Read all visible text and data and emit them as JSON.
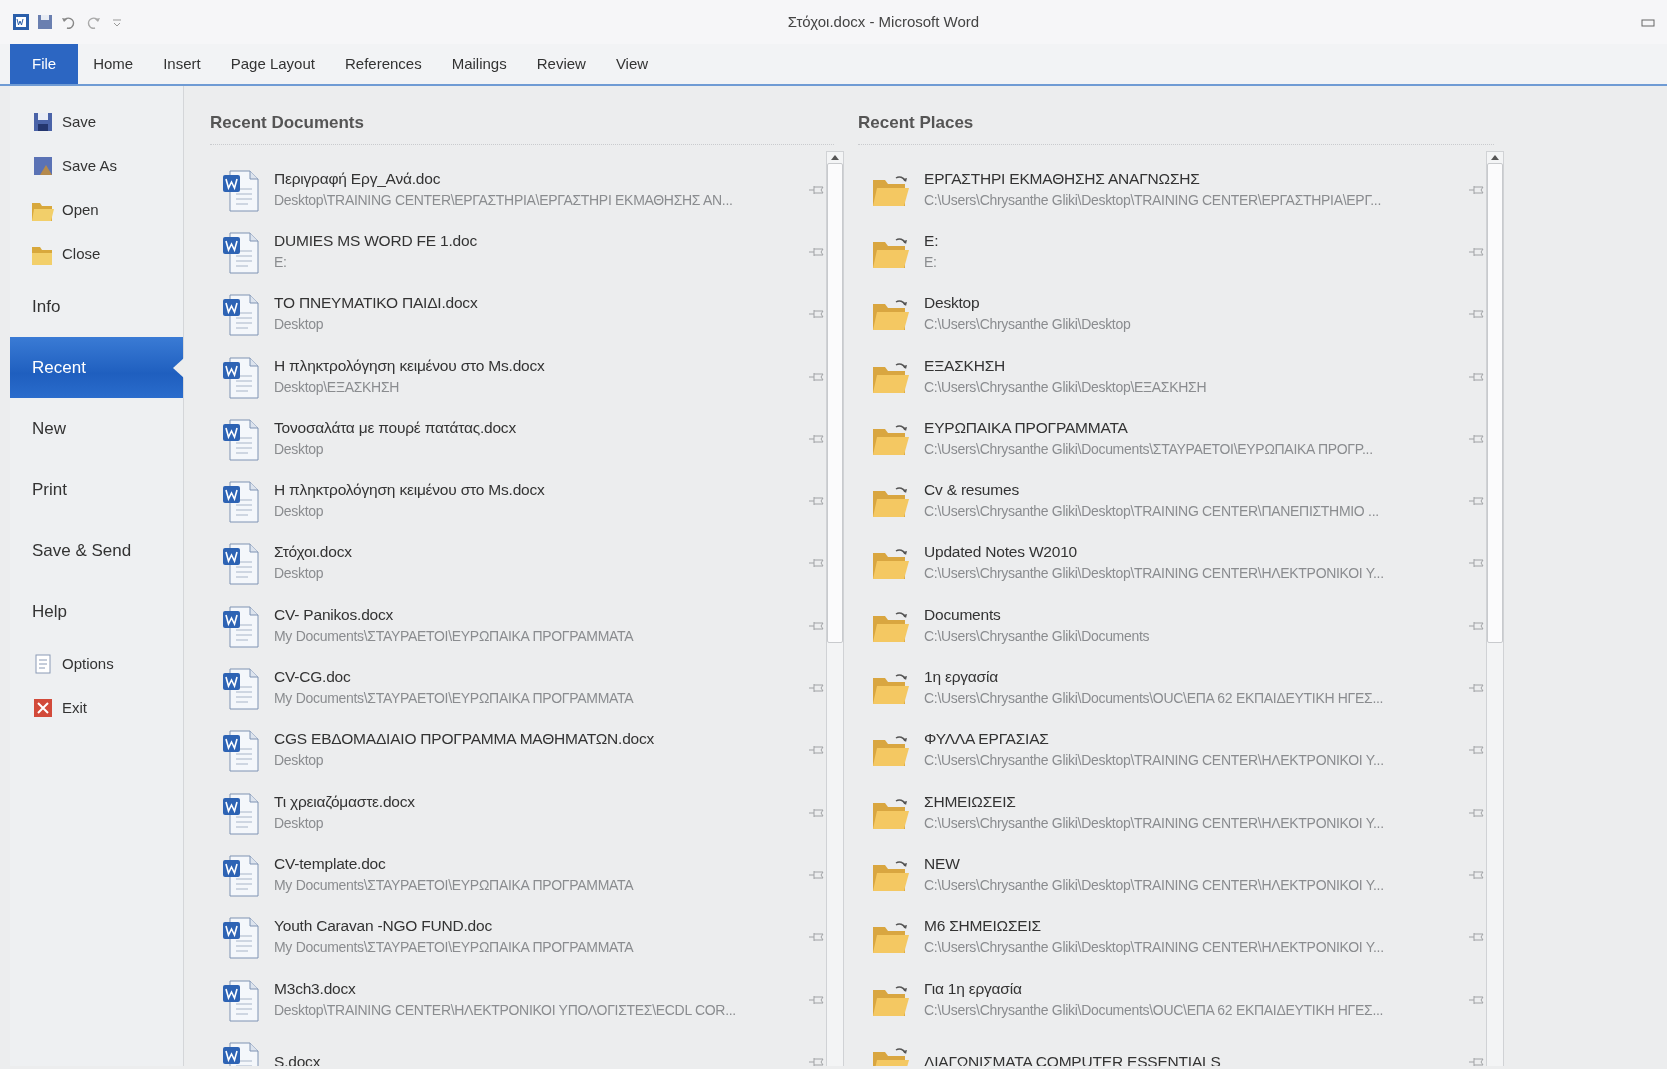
{
  "window": {
    "title": "Στόχοι.docx - Microsoft Word"
  },
  "tabs": [
    {
      "label": "File",
      "selected": true
    },
    {
      "label": "Home",
      "selected": false
    },
    {
      "label": "Insert",
      "selected": false
    },
    {
      "label": "Page Layout",
      "selected": false
    },
    {
      "label": "References",
      "selected": false
    },
    {
      "label": "Mailings",
      "selected": false
    },
    {
      "label": "Review",
      "selected": false
    },
    {
      "label": "View",
      "selected": false
    }
  ],
  "backstage_menu": [
    {
      "label": "Save",
      "kind": "command",
      "selected": false
    },
    {
      "label": "Save As",
      "kind": "command",
      "selected": false
    },
    {
      "label": "Open",
      "kind": "command",
      "selected": false
    },
    {
      "label": "Close",
      "kind": "command",
      "selected": false
    },
    {
      "label": "Info",
      "kind": "page",
      "selected": false
    },
    {
      "label": "Recent",
      "kind": "page",
      "selected": true
    },
    {
      "label": "New",
      "kind": "page",
      "selected": false
    },
    {
      "label": "Print",
      "kind": "page",
      "selected": false
    },
    {
      "label": "Save & Send",
      "kind": "page",
      "selected": false
    },
    {
      "label": "Help",
      "kind": "page",
      "selected": false
    },
    {
      "label": "Options",
      "kind": "command",
      "selected": false
    },
    {
      "label": "Exit",
      "kind": "command",
      "selected": false
    }
  ],
  "recent_documents": {
    "title": "Recent Documents",
    "items": [
      {
        "name": "Περιγραφή Εργ_Ανά.doc",
        "path": "Desktop\\TRAINING CENTER\\ΕΡΓΑΣΤΗΡΙΑ\\ΕΡΓΑΣΤΗΡΙ ΕΚΜΑΘΗΣΗΣ ΑΝ..."
      },
      {
        "name": "DUMIES MS WORD FE  1.doc",
        "path": "E:"
      },
      {
        "name": "ΤΟ ΠΝΕΥΜΑΤΙΚΟ ΠΑΙΔΙ.docx",
        "path": "Desktop"
      },
      {
        "name": "Η πληκτρολόγηση κειμένου στο Ms.docx",
        "path": "Desktop\\ΕΞΑΣΚΗΣΗ"
      },
      {
        "name": "Τονοσαλάτα με πουρέ πατάτας.docx",
        "path": "Desktop"
      },
      {
        "name": "Η πληκτρολόγηση κειμένου στο Ms.docx",
        "path": "Desktop"
      },
      {
        "name": "Στόχοι.docx",
        "path": "Desktop"
      },
      {
        "name": "CV- Panikos.docx",
        "path": "My Documents\\ΣΤΑΥΡΑΕΤΟΙ\\ΕΥΡΩΠΑΙΚΑ ΠΡΟΓΡΑΜΜΑΤΑ"
      },
      {
        "name": "CV-CG.doc",
        "path": "My Documents\\ΣΤΑΥΡΑΕΤΟΙ\\ΕΥΡΩΠΑΙΚΑ ΠΡΟΓΡΑΜΜΑΤΑ"
      },
      {
        "name": "CGS ΕΒΔΟΜΑΔΙΑΙΟ ΠΡΟΓΡΑΜΜΑ ΜΑΘΗΜΑΤΩΝ.docx",
        "path": "Desktop"
      },
      {
        "name": "Τι χρειαζόμαστε.docx",
        "path": "Desktop"
      },
      {
        "name": "CV-template.doc",
        "path": "My Documents\\ΣΤΑΥΡΑΕΤΟΙ\\ΕΥΡΩΠΑΙΚΑ ΠΡΟΓΡΑΜΜΑΤΑ"
      },
      {
        "name": "Youth Caravan -NGO FUND.doc",
        "path": "My Documents\\ΣΤΑΥΡΑΕΤΟΙ\\ΕΥΡΩΠΑΙΚΑ ΠΡΟΓΡΑΜΜΑΤΑ"
      },
      {
        "name": "M3ch3.docx",
        "path": "Desktop\\TRAINING CENTER\\ΗΛΕΚΤΡΟΝΙΚΟΙ ΥΠΟΛΟΓΙΣΤΕΣ\\ECDL COR..."
      },
      {
        "name": "S.docx"
      }
    ]
  },
  "recent_places": {
    "title": "Recent Places",
    "items": [
      {
        "name": "ΕΡΓΑΣΤΗΡΙ ΕΚΜΑΘΗΣΗΣ ΑΝΑΓΝΩΣΗΣ",
        "path": "C:\\Users\\Chrysanthe Gliki\\Desktop\\TRAINING CENTER\\ΕΡΓΑΣΤΗΡΙΑ\\ΕΡΓ..."
      },
      {
        "name": "E:",
        "path": "E:"
      },
      {
        "name": "Desktop",
        "path": "C:\\Users\\Chrysanthe Gliki\\Desktop"
      },
      {
        "name": "ΕΞΑΣΚΗΣΗ",
        "path": "C:\\Users\\Chrysanthe Gliki\\Desktop\\ΕΞΑΣΚΗΣΗ"
      },
      {
        "name": "ΕΥΡΩΠΑΙΚΑ ΠΡΟΓΡΑΜΜΑΤΑ",
        "path": "C:\\Users\\Chrysanthe Gliki\\Documents\\ΣΤΑΥΡΑΕΤΟΙ\\ΕΥΡΩΠΑΙΚΑ ΠΡΟΓΡ..."
      },
      {
        "name": "Cv & resumes",
        "path": "C:\\Users\\Chrysanthe Gliki\\Desktop\\TRAINING CENTER\\ΠΑΝΕΠΙΣΤΗΜΙΟ ..."
      },
      {
        "name": "Updated Notes W2010",
        "path": "C:\\Users\\Chrysanthe Gliki\\Desktop\\TRAINING CENTER\\ΗΛΕΚΤΡΟΝΙΚΟΙ Υ..."
      },
      {
        "name": "Documents",
        "path": "C:\\Users\\Chrysanthe Gliki\\Documents"
      },
      {
        "name": "1η εργασία",
        "path": "C:\\Users\\Chrysanthe Gliki\\Documents\\OUC\\ΕΠΑ 62 ΕΚΠΑΙΔΕΥΤΙΚΗ ΗΓΕΣ..."
      },
      {
        "name": "ΦΥΛΛΑ ΕΡΓΑΣΙΑΣ",
        "path": "C:\\Users\\Chrysanthe Gliki\\Desktop\\TRAINING CENTER\\ΗΛΕΚΤΡΟΝΙΚΟΙ Υ..."
      },
      {
        "name": "ΣΗΜΕΙΩΣΕΙΣ",
        "path": "C:\\Users\\Chrysanthe Gliki\\Desktop\\TRAINING CENTER\\ΗΛΕΚΤΡΟΝΙΚΟΙ Υ..."
      },
      {
        "name": "NEW",
        "path": "C:\\Users\\Chrysanthe Gliki\\Desktop\\TRAINING CENTER\\ΗΛΕΚΤΡΟΝΙΚΟΙ Υ..."
      },
      {
        "name": "M6 ΣΗΜΕΙΩΣΕΙΣ",
        "path": "C:\\Users\\Chrysanthe Gliki\\Desktop\\TRAINING CENTER\\ΗΛΕΚΤΡΟΝΙΚΟΙ Υ..."
      },
      {
        "name": "Για 1η εργασία",
        "path": "C:\\Users\\Chrysanthe Gliki\\Documents\\OUC\\ΕΠΑ 62 ΕΚΠΑΙΔΕΥΤΙΚΗ ΗΓΕΣ..."
      },
      {
        "name": "ΔΙΑΓΩΝΙΣΜΑΤΑ COMPUTER ESSENTIALS"
      }
    ]
  }
}
